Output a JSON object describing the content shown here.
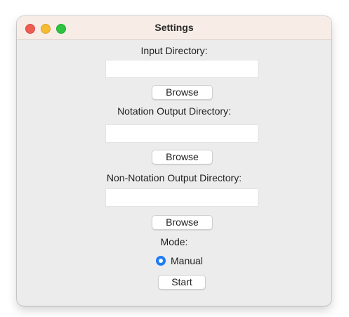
{
  "window": {
    "title": "Settings"
  },
  "colors": {
    "titlebar": "#f8ece6",
    "window_background": "#ececec",
    "close": "#ee5c54",
    "minimize": "#f6bc30",
    "maximize": "#2fc440",
    "radio_accent": "#1e7cf6"
  },
  "form": {
    "input_directory": {
      "label": "Input Directory:",
      "value": "",
      "browse_label": "Browse"
    },
    "notation_output_directory": {
      "label": "Notation Output Directory:",
      "value": "",
      "browse_label": "Browse"
    },
    "non_notation_output_directory": {
      "label": "Non-Notation Output Directory:",
      "value": "",
      "browse_label": "Browse"
    },
    "mode": {
      "label": "Mode:",
      "options": [
        {
          "label": "Manual",
          "selected": true
        }
      ]
    },
    "start_label": "Start"
  }
}
